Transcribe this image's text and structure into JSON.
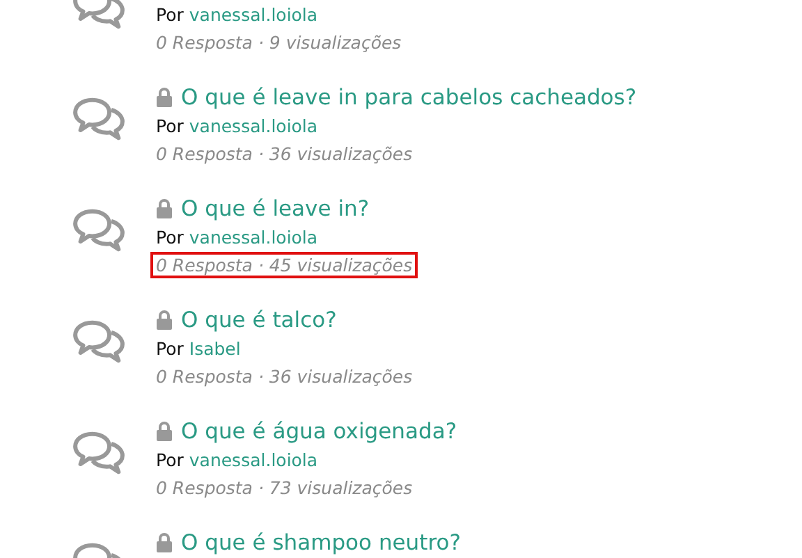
{
  "topics": [
    {
      "author_prefix": "Por",
      "author": "vanessal.loiola",
      "stats": "0 Resposta · 9 visualizações",
      "highlighted": false
    },
    {
      "title": "O que é leave in para cabelos cacheados?",
      "locked": true,
      "author_prefix": "Por",
      "author": "vanessal.loiola",
      "stats": "0 Resposta · 36 visualizações",
      "highlighted": false
    },
    {
      "title": "O que é leave in?",
      "locked": true,
      "author_prefix": "Por",
      "author": "vanessal.loiola",
      "stats": "0 Resposta · 45 visualizações",
      "highlighted": true
    },
    {
      "title": "O que é talco?",
      "locked": true,
      "author_prefix": "Por",
      "author": "Isabel",
      "stats": "0 Resposta · 36 visualizações",
      "highlighted": false
    },
    {
      "title": "O que é água oxigenada?",
      "locked": true,
      "author_prefix": "Por",
      "author": "vanessal.loiola",
      "stats": "0 Resposta · 73 visualizações",
      "highlighted": false
    },
    {
      "title": "O que é shampoo neutro?",
      "locked": true
    }
  ]
}
